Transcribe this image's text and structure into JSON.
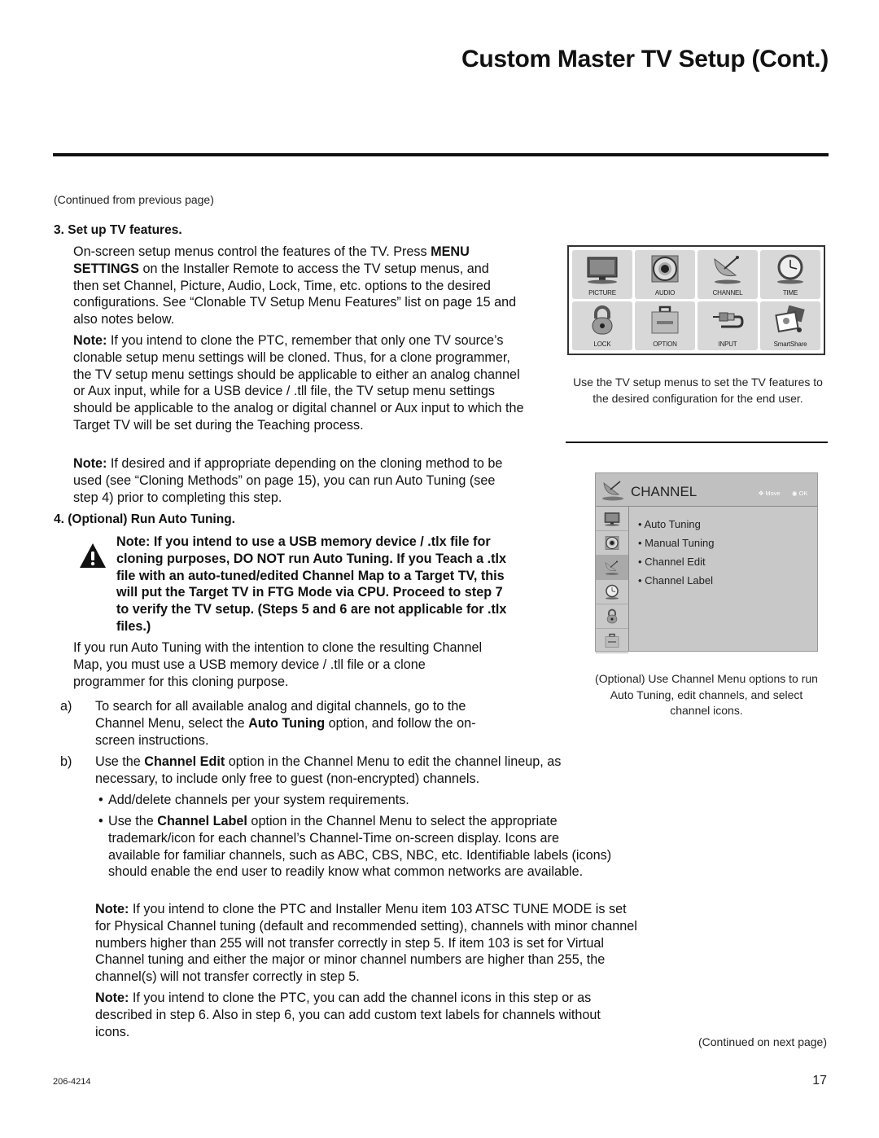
{
  "page": {
    "title": "Custom Master TV Setup (Cont.)",
    "continued_from": "(Continued from previous page)",
    "continued_next": "(Continued on next page)",
    "doc_number": "206-4214",
    "page_number": "17"
  },
  "step3": {
    "heading": "3.  Set up TV features.",
    "para1": [
      {
        "t": "On-screen setup menus control the features of the TV. Press "
      },
      {
        "t": "MENU SETTINGS",
        "b": true
      },
      {
        "t": " on the Installer Remote to access the TV setup menus, and then set Channel, Picture, Audio, Lock, Time, etc. options to the desired configurations. See “Clonable TV Setup Menu Features” list on page 15 and also notes below."
      }
    ],
    "note1_label": "Note:",
    "note1": " If you intend to clone the PTC, remember that only one TV source’s clonable setup menu settings will be cloned. Thus, for a clone programmer, the TV setup menu settings should be applicable to either an analog channel or Aux input, while for a USB device / .tll file, the TV setup menu settings should be applicable to the analog or digital channel or Aux input to which the Target TV will be set during the Teaching process.",
    "note2_label": "Note:",
    "note2": " If desired and if appropriate depending on the cloning method to be used (see “Cloning Methods” on page 15), you can run Auto Tuning (see step 4) prior to completing this step."
  },
  "step4": {
    "heading": "4.  (Optional) Run Auto Tuning.",
    "warning": "Note: If you intend to use a USB memory device / .tlx file for cloning purposes, DO NOT run Auto Tuning. If you Teach a .tlx file with an auto-tuned/edited Channel Map to a Target TV, this will put the Target TV in FTG Mode via CPU. Proceed to step 7 to verify the TV setup. (Steps 5 and 6 are not applicable for .tlx files.)",
    "para": "If you run Auto Tuning with the intention to clone the resulting Channel Map, you must use a USB memory device / .tll file or a clone programmer for this cloning purpose.",
    "item_a_marker": "a)",
    "item_a": [
      {
        "t": "To search for all available analog and digital channels, go to the Channel Menu, select the "
      },
      {
        "t": "Auto Tuning",
        "b": true
      },
      {
        "t": " option, and follow the on-screen instructions."
      }
    ],
    "item_b_marker": "b)",
    "item_b": [
      {
        "t": "Use the "
      },
      {
        "t": "Channel Edit",
        "b": true
      },
      {
        "t": " option in the Channel Menu to edit the channel lineup, as necessary, to include only free to guest (non-encrypted) channels."
      }
    ],
    "bullet1": "Add/delete channels per your system requirements.",
    "bullet2": [
      {
        "t": "Use the "
      },
      {
        "t": "Channel Label",
        "b": true
      },
      {
        "t": " option in the Channel Menu to select the appropriate trademark/icon for each channel’s Channel-Time on-screen display. Icons are available for familiar channels, such as ABC, CBS, NBC, etc. Identifiable labels (icons) should enable the end user to readily know what common networks are available."
      }
    ],
    "note3_label": "Note:",
    "note3": " If you intend to clone the PTC and Installer Menu item 103 ATSC TUNE MODE is set for Physical Channel tuning (default and recommended setting), channels with minor channel numbers higher than 255 will not transfer correctly in step 5. If item 103 is set for Virtual Channel tuning and either the major or minor channel numbers are higher than 255, the channel(s) will not transfer correctly in step 5.",
    "note4_label": "Note:",
    "note4": " If you intend to clone the PTC, you can add the channel icons in this step or as described in step 6. Also in step 6, you can add custom text labels for channels without icons."
  },
  "menu_grid": {
    "tiles": [
      {
        "label": "PICTURE",
        "icon": "tv-icon"
      },
      {
        "label": "AUDIO",
        "icon": "speaker-icon"
      },
      {
        "label": "CHANNEL",
        "icon": "satellite-dish-icon"
      },
      {
        "label": "TIME",
        "icon": "clock-icon"
      },
      {
        "label": "LOCK",
        "icon": "padlock-icon"
      },
      {
        "label": "OPTION",
        "icon": "toolbox-icon"
      },
      {
        "label": "INPUT",
        "icon": "cable-plug-icon"
      },
      {
        "label": "SmartShare",
        "icon": "media-icon"
      }
    ],
    "caption": "Use the TV setup menus to set the TV features to the desired configuration for the end user."
  },
  "channel_menu": {
    "title": "CHANNEL",
    "move_hint": "Move",
    "ok_hint": "OK",
    "items": [
      "• Auto Tuning",
      "• Manual Tuning",
      "• Channel Edit",
      "• Channel Label"
    ],
    "side_icons": [
      "tv-icon",
      "speaker-icon",
      "satellite-dish-icon",
      "clock-icon",
      "padlock-icon",
      "toolbox-icon"
    ],
    "active_index": 2,
    "caption": "(Optional) Use Channel Menu options to run Auto Tuning, edit channels, and select channel icons."
  }
}
